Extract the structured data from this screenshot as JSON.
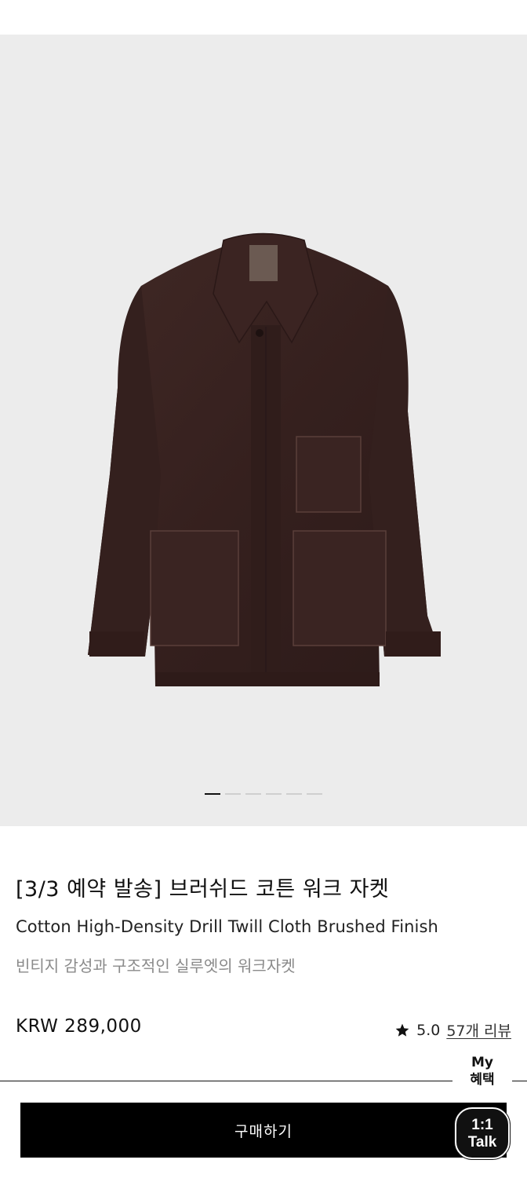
{
  "gallery": {
    "image_alt": "Brushed cotton work jacket, dark brown",
    "slide_count": 6,
    "active_slide": 1,
    "background": "#ececec",
    "product_color": "#3a2422"
  },
  "product": {
    "title": "[3/3 예약 발송] 브러쉬드 코튼 워크 자켓",
    "subtitle": "Cotton High-Density Drill Twill Cloth Brushed Finish",
    "description": "빈티지 감성과 구조적인 실루엣의 워크자켓",
    "price": "KRW 289,000",
    "rating": "5.0",
    "review_link": "57개 리뷰"
  },
  "floating": {
    "my_benefit_line1": "My",
    "my_benefit_line2": "혜택",
    "talk_line1": "1:1",
    "talk_line2": "Talk"
  },
  "actions": {
    "buy_label": "구매하기"
  }
}
